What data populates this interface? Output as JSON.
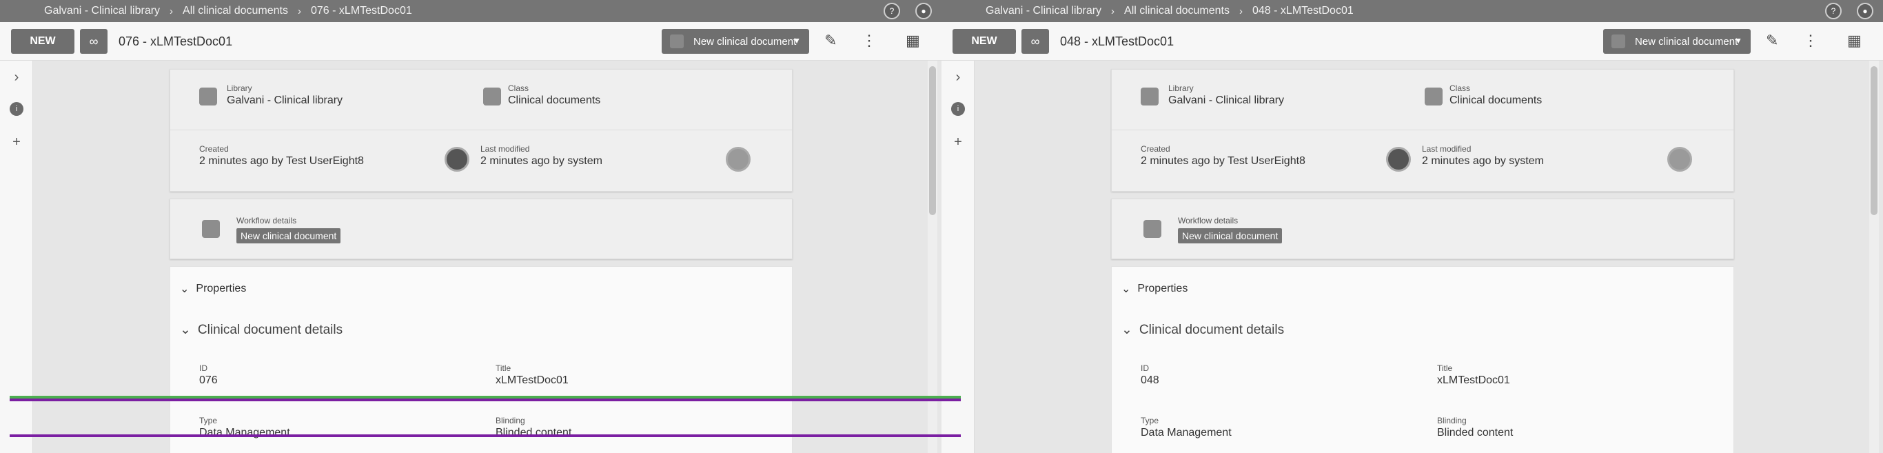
{
  "panes": [
    {
      "breadcrumb": [
        "Galvani - Clinical library",
        "All clinical documents",
        "076 - xLMTestDoc01"
      ],
      "toolbar": {
        "new_label": "NEW",
        "doc_title": "076 - xLMTestDoc01",
        "workflow_button": "New clinical document"
      },
      "summary": {
        "library_label": "Library",
        "library_value": "Galvani - Clinical library",
        "class_label": "Class",
        "class_value": "Clinical documents",
        "created_label": "Created",
        "created_value": "2 minutes ago by Test UserEight8",
        "modified_label": "Last modified",
        "modified_value": "2 minutes ago by system"
      },
      "workflow": {
        "label": "Workflow details",
        "chip": "New clinical document"
      },
      "properties": {
        "heading": "Properties",
        "section": "Clinical document details",
        "id_label": "ID",
        "id_value": "076",
        "title_label": "Title",
        "title_value": "xLMTestDoc01",
        "type_label": "Type",
        "type_value": "Data Management",
        "blinding_label": "Blinding",
        "blinding_value": "Blinded content"
      }
    },
    {
      "breadcrumb": [
        "Galvani - Clinical library",
        "All clinical documents",
        "048 - xLMTestDoc01"
      ],
      "toolbar": {
        "new_label": "NEW",
        "doc_title": "048 - xLMTestDoc01",
        "workflow_button": "New clinical document"
      },
      "summary": {
        "library_label": "Library",
        "library_value": "Galvani - Clinical library",
        "class_label": "Class",
        "class_value": "Clinical documents",
        "created_label": "Created",
        "created_value": "2 minutes ago by Test UserEight8",
        "modified_label": "Last modified",
        "modified_value": "2 minutes ago by system"
      },
      "workflow": {
        "label": "Workflow details",
        "chip": "New clinical document"
      },
      "properties": {
        "heading": "Properties",
        "section": "Clinical document details",
        "id_label": "ID",
        "id_value": "048",
        "title_label": "Title",
        "title_value": "xLMTestDoc01",
        "type_label": "Type",
        "type_value": "Data Management",
        "blinding_label": "Blinding",
        "blinding_value": "Blinded content"
      }
    }
  ],
  "colors": {
    "bar": "#757575",
    "button": "#6f6f6f",
    "overlay_green": "#4caf50",
    "overlay_purple": "#7b1fa2"
  }
}
